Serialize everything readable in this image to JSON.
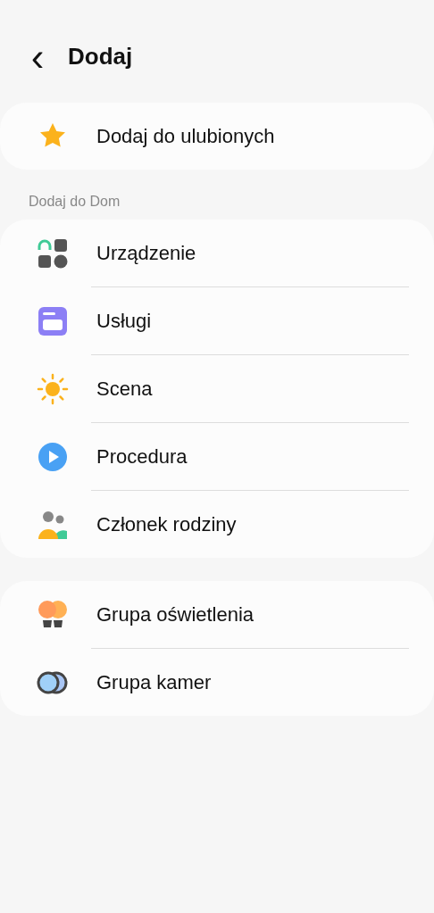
{
  "header": {
    "back": "‹",
    "title": "Dodaj"
  },
  "groups": [
    {
      "items": [
        {
          "kind": "star",
          "label": "Dodaj do ulubionych"
        }
      ]
    },
    {
      "heading": "Dodaj do Dom",
      "items": [
        {
          "kind": "device",
          "label": "Urządzenie"
        },
        {
          "kind": "services",
          "label": "Usługi"
        },
        {
          "kind": "scene",
          "label": "Scena"
        },
        {
          "kind": "routine",
          "label": "Procedura"
        },
        {
          "kind": "member",
          "label": "Członek rodziny"
        }
      ]
    },
    {
      "items": [
        {
          "kind": "lights",
          "label": "Grupa oświetlenia"
        },
        {
          "kind": "cameras",
          "label": "Grupa kamer"
        }
      ]
    }
  ]
}
